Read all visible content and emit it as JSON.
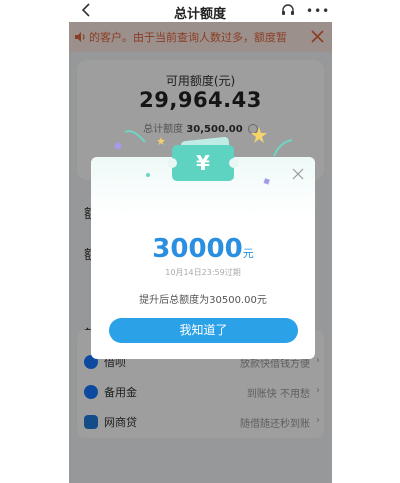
{
  "nav": {
    "title": "总计额度",
    "more": "•••"
  },
  "notice": {
    "text": "的客户。由于当前查询人数过多，额度暂"
  },
  "quota": {
    "label": "可用额度(元)",
    "amount": "29,964.43",
    "total_label": "总计额度",
    "total_value": "30,500.00"
  },
  "background_labels": {
    "left_a": "额",
    "left_b": "额",
    "left_c": "其"
  },
  "products": [
    {
      "name": "借呗",
      "desc": "放款快借钱方便",
      "icon": "jiebei-icon",
      "color": "#1677ff"
    },
    {
      "name": "备用金",
      "desc": "到账快 不用愁",
      "icon": "beiyongjin-icon",
      "color": "#1677ff"
    },
    {
      "name": "网商贷",
      "desc": "随借随还秒到账",
      "icon": "wangshangdai-icon",
      "color": "#1f7bd9"
    }
  ],
  "modal": {
    "ticket_symbol": "¥",
    "amount": "30000",
    "unit": "元",
    "expire": "10月14日23:59过期",
    "raise_text": "提升后总额度为30500.00元",
    "button_label": "我知道了"
  },
  "colors": {
    "accent": "#2ba1e8",
    "notice": "#e0633c",
    "ticket": "#5fd3c2"
  }
}
